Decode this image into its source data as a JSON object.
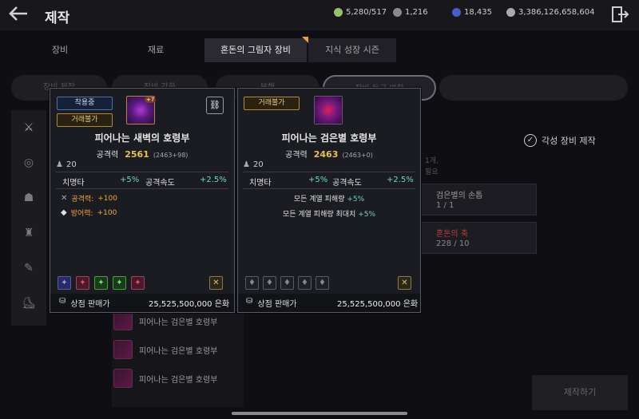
{
  "header": {
    "title": "제작",
    "currencies": [
      {
        "icon": "gem-icon",
        "value": "5,280/517",
        "color": "#9bc06a"
      },
      {
        "icon": "crystal-icon",
        "value": "1,216",
        "color": "#8a8a8a"
      },
      {
        "icon": "blue-coin-icon",
        "value": "18,435",
        "color": "#4a5cc8"
      },
      {
        "icon": "silver-coin-icon",
        "value": "3,386,126,658,604",
        "color": "#aaaaaa"
      }
    ]
  },
  "tabs": [
    "장비",
    "재료",
    "혼돈의 그림자 장비",
    "지식 성장 시즌"
  ],
  "active_tab": "혼돈의 그림자 장비",
  "subtabs": [
    "장비 제작",
    "장비 강화",
    "분해",
    "장비 등급 변환"
  ],
  "active_subtab": "장비 등급 변환",
  "list_rows": [
    "피어나는 검은별 호령부",
    "피어나는 검은별 호령부",
    "피어나는 검은별 호령부"
  ],
  "right_panel": {
    "awaken_label": "각성 장비 제작",
    "bg_line1": "1개,",
    "bg_line2": "필요",
    "materials": [
      {
        "name": "검은별의 손톱",
        "count": "1 / 1"
      },
      {
        "name": "혼돈의 축",
        "count": "228 / 10"
      }
    ],
    "craft_button": "제작하기"
  },
  "card_left": {
    "badge_equipped": "착용중",
    "badge_untradeable": "거래불가",
    "upgrade": "+7",
    "name": "피어나는 새벽의 호령부",
    "attack_label": "공격력",
    "attack_value": "2561",
    "attack_detail": "(2463+98)",
    "level": "20",
    "crit_label": "치명타",
    "crit_value": "+5%",
    "speed_label": "공격속도",
    "speed_value": "+2.5%",
    "bonus1_label": "공격력:",
    "bonus1_value": "+100",
    "bonus2_label": "방어력:",
    "bonus2_value": "+100",
    "sell_label": "상점 판매가",
    "sell_value": "25,525,500,000 은화"
  },
  "card_right": {
    "badge_untradeable": "거래불가",
    "name": "피어나는 검은별 호령부",
    "attack_label": "공격력",
    "attack_value": "2463",
    "attack_detail": "(2463+0)",
    "level": "20",
    "crit_label": "치명타",
    "crit_value": "+5%",
    "speed_label": "공격속도",
    "speed_value": "+2.5%",
    "effect1": "모든 계열 피해량",
    "effect1_value": "+5%",
    "effect2": "모든 계열 피해량 최대치",
    "effect2_value": "+5%",
    "sell_label": "상점 판매가",
    "sell_value": "25,525,500,000 은화"
  }
}
